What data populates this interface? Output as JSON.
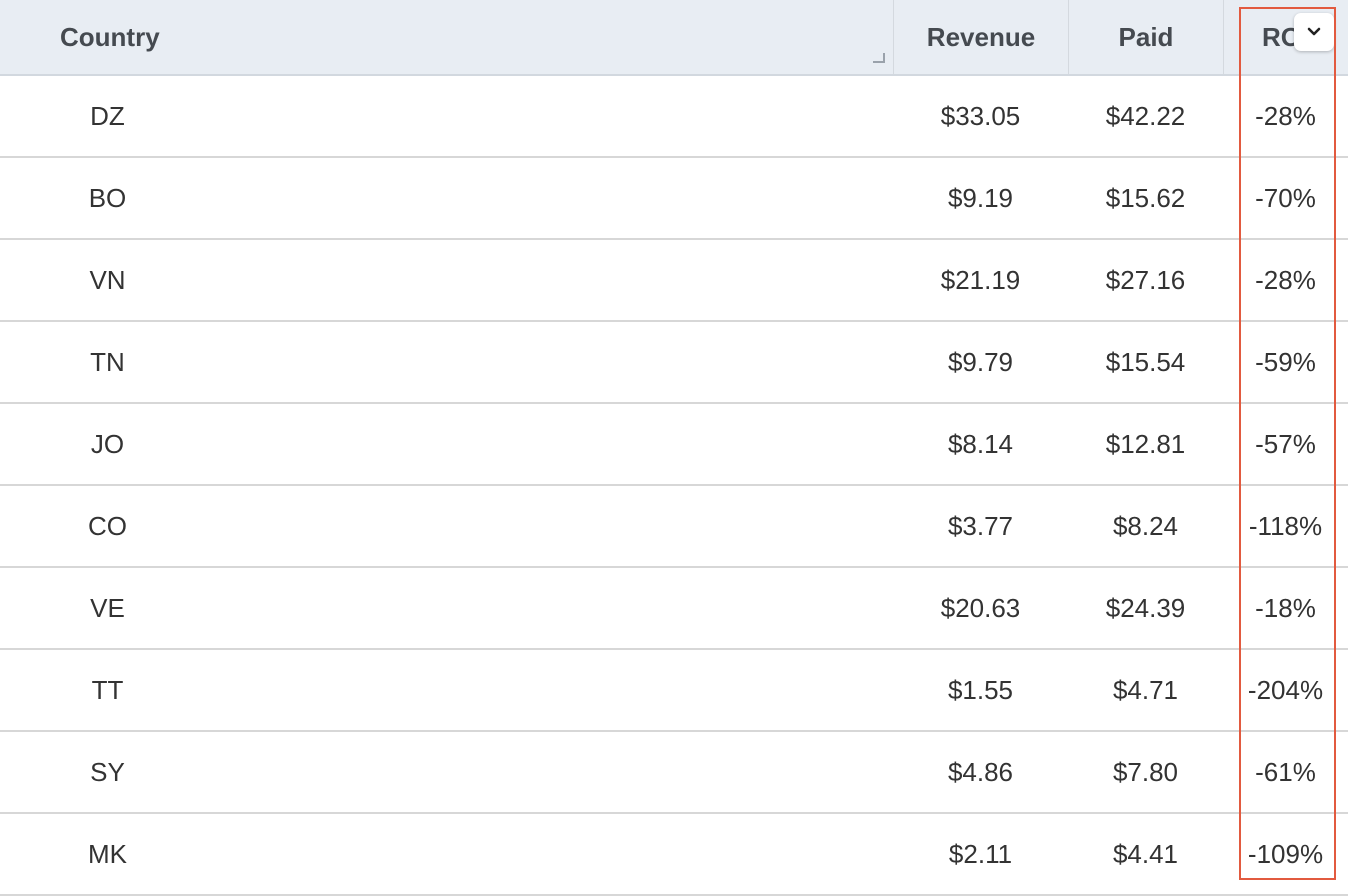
{
  "columns": {
    "country": "Country",
    "revenue": "Revenue",
    "paid": "Paid",
    "roi": "RO"
  },
  "header_menu_icon": "chevron-down-icon",
  "highlight_color": "#e25a3f",
  "rows": [
    {
      "country": "DZ",
      "revenue": "$33.05",
      "paid": "$42.22",
      "roi": "-28%"
    },
    {
      "country": "BO",
      "revenue": "$9.19",
      "paid": "$15.62",
      "roi": "-70%"
    },
    {
      "country": "VN",
      "revenue": "$21.19",
      "paid": "$27.16",
      "roi": "-28%"
    },
    {
      "country": "TN",
      "revenue": "$9.79",
      "paid": "$15.54",
      "roi": "-59%"
    },
    {
      "country": "JO",
      "revenue": "$8.14",
      "paid": "$12.81",
      "roi": "-57%"
    },
    {
      "country": "CO",
      "revenue": "$3.77",
      "paid": "$8.24",
      "roi": "-118%"
    },
    {
      "country": "VE",
      "revenue": "$20.63",
      "paid": "$24.39",
      "roi": "-18%"
    },
    {
      "country": "TT",
      "revenue": "$1.55",
      "paid": "$4.71",
      "roi": "-204%"
    },
    {
      "country": "SY",
      "revenue": "$4.86",
      "paid": "$7.80",
      "roi": "-61%"
    },
    {
      "country": "MK",
      "revenue": "$2.11",
      "paid": "$4.41",
      "roi": "-109%"
    }
  ]
}
